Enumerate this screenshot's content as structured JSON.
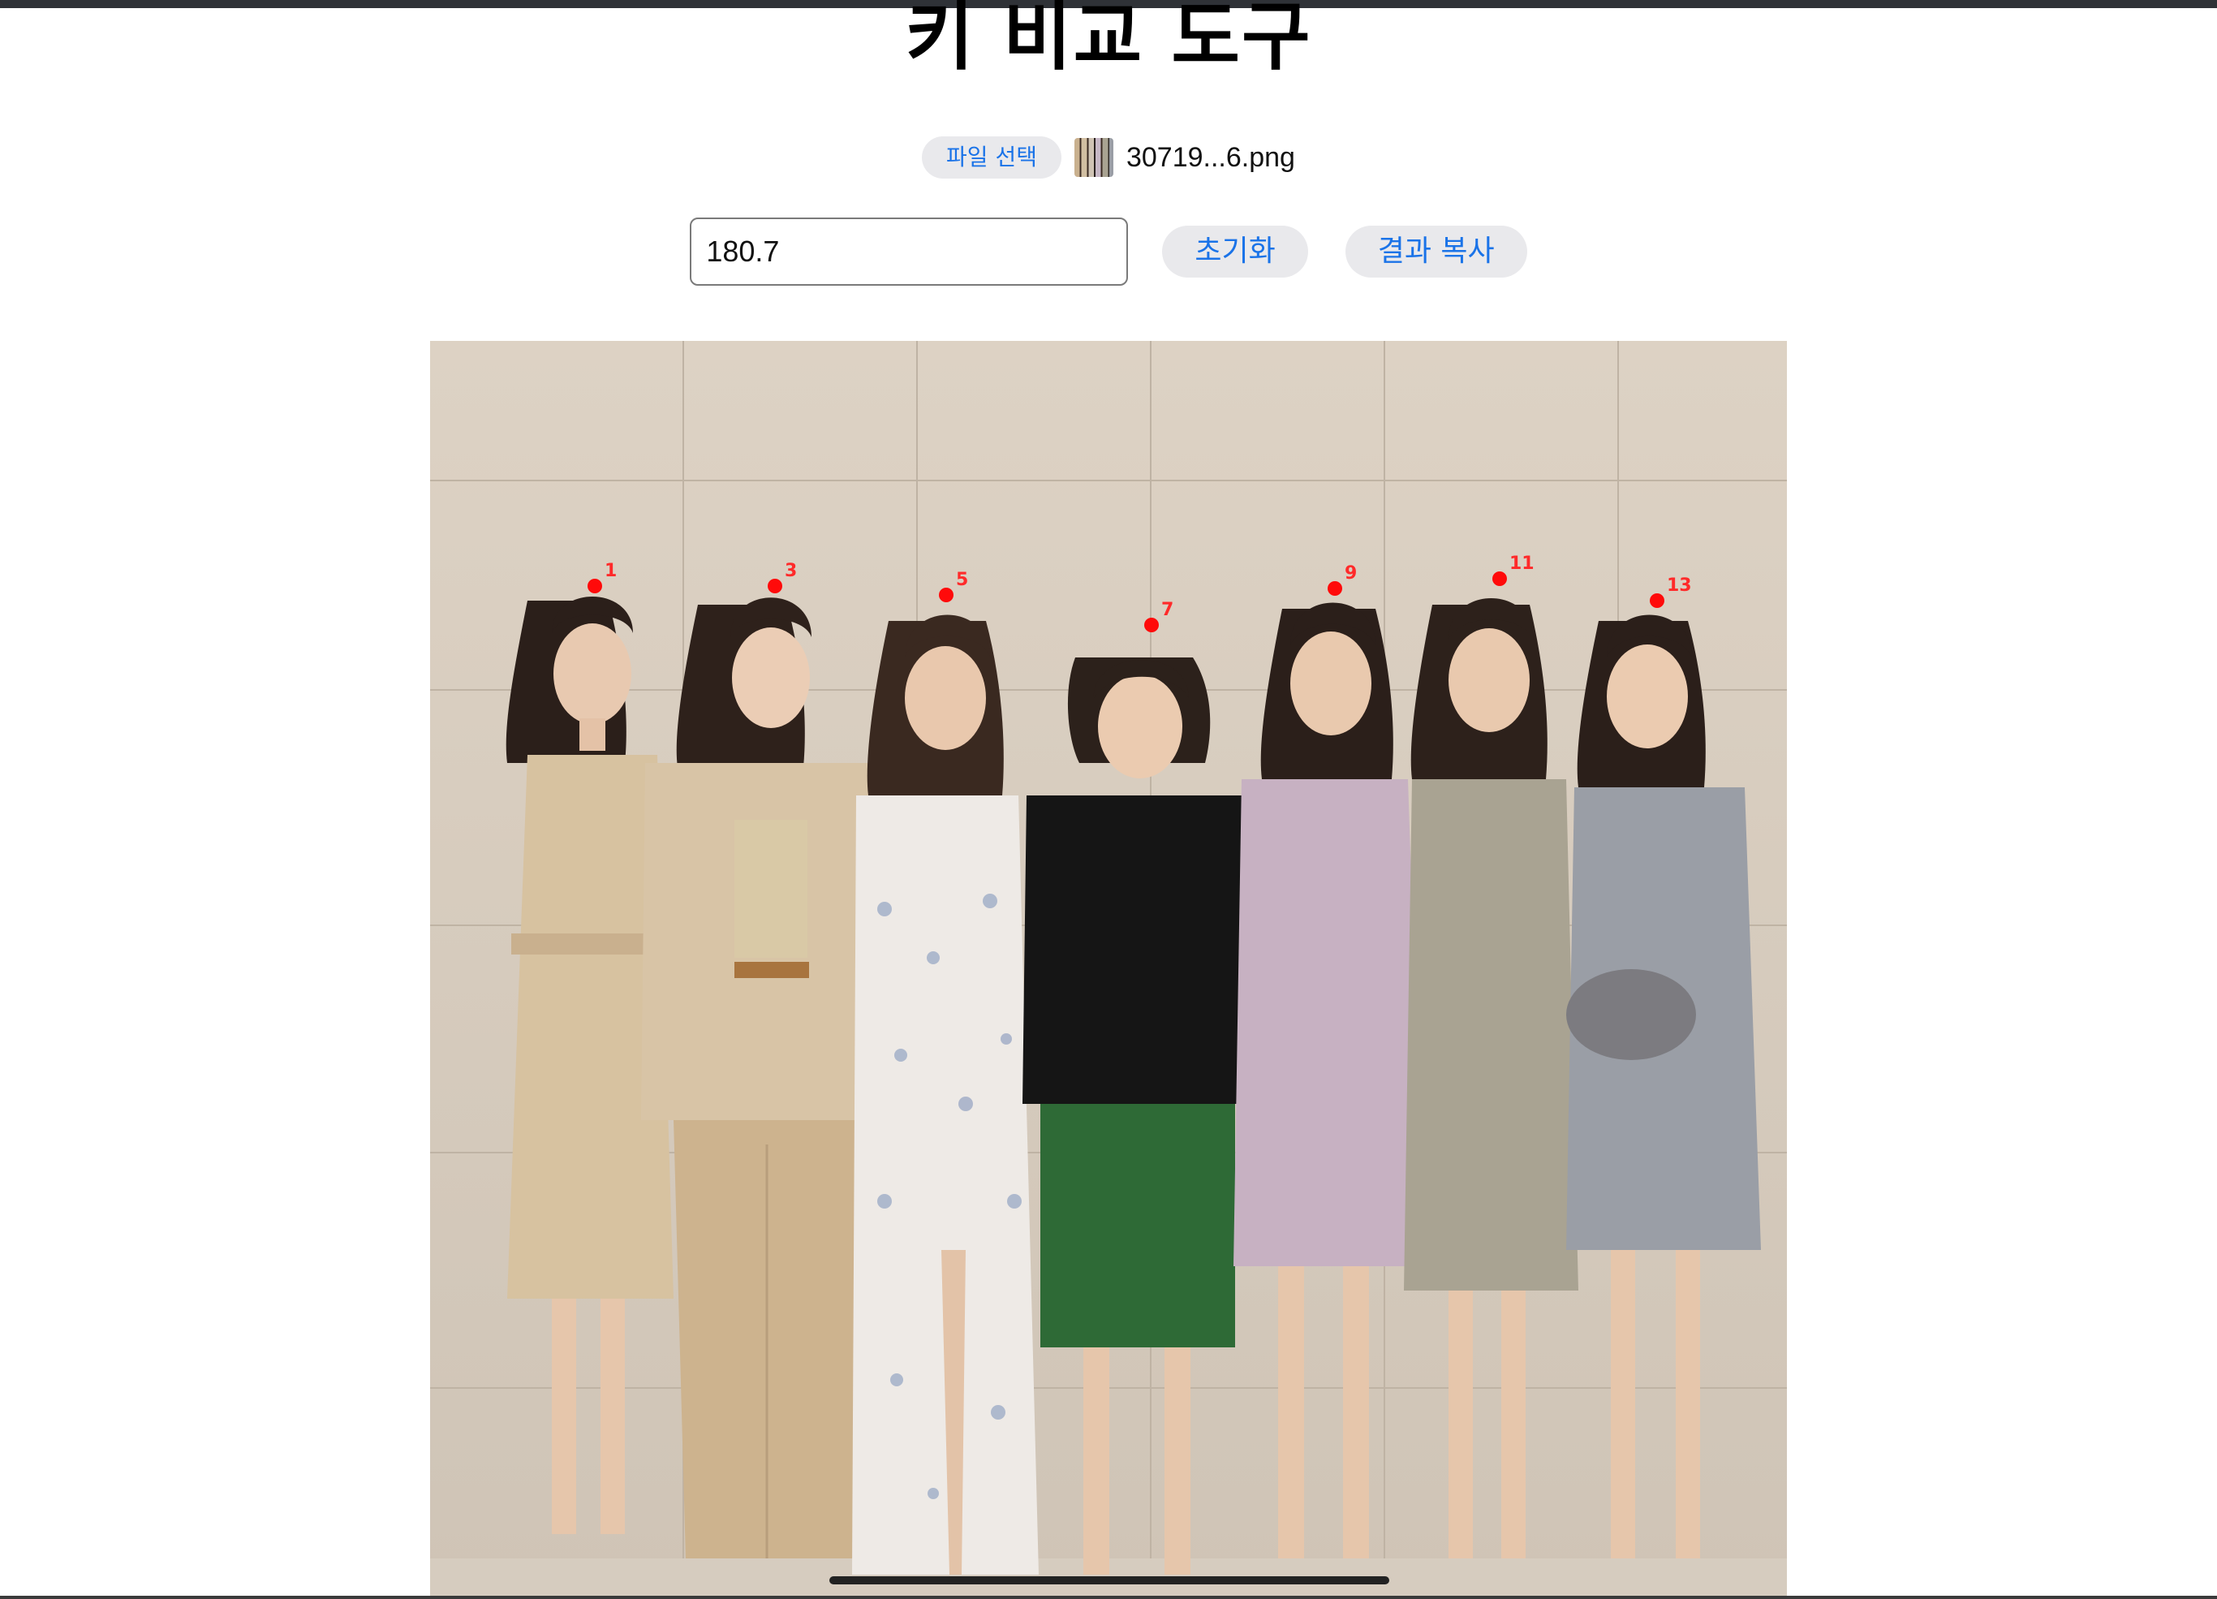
{
  "page": {
    "title": "키 비교 도구"
  },
  "file_picker": {
    "button_label": "파일 선택",
    "file_name": "30719...6.png"
  },
  "controls": {
    "height_value": "180.7",
    "reset_label": "초기화",
    "copy_label": "결과 복사"
  },
  "photo": {
    "description_icon": "photo-of-seven-women",
    "markers": [
      {
        "label": "1"
      },
      {
        "label": "3"
      },
      {
        "label": "5"
      },
      {
        "label": "7"
      },
      {
        "label": "9"
      },
      {
        "label": "11"
      },
      {
        "label": "13"
      }
    ]
  },
  "colors": {
    "accent": "#1a73e8",
    "button_bg": "#e9e9ec",
    "marker": "#ff0a0a"
  }
}
